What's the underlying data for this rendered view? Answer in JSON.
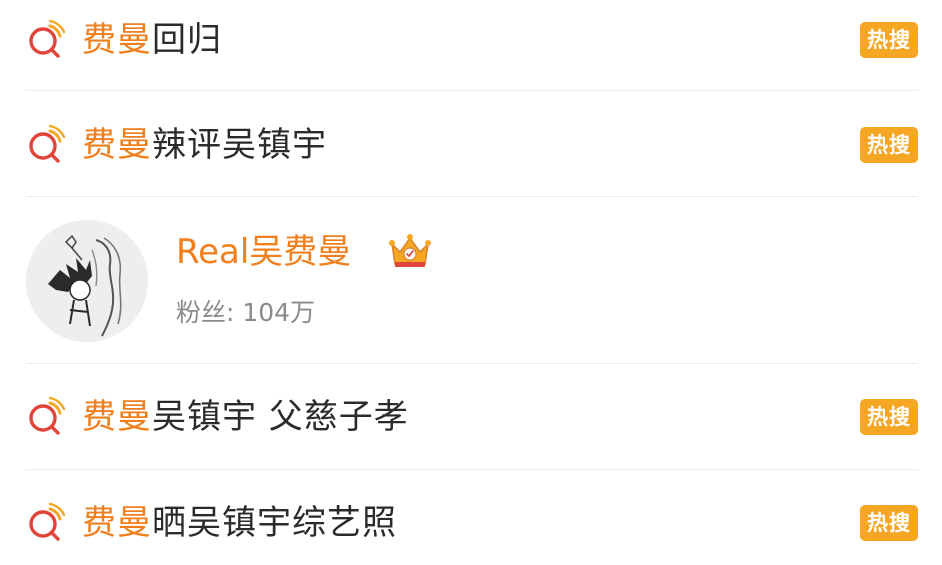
{
  "results": [
    {
      "highlight": "费曼",
      "rest": "回归",
      "badge": "热搜",
      "icon": "search-icon"
    },
    {
      "highlight": "费曼",
      "rest": "辣评吴镇宇",
      "badge": "热搜",
      "icon": "search-icon"
    },
    {
      "highlight": "费曼",
      "rest": "吴镇宇 父慈子孝",
      "badge": "热搜",
      "icon": "search-icon"
    },
    {
      "highlight": "费曼",
      "rest": "晒吴镇宇综艺照",
      "badge": "热搜",
      "icon": "search-icon"
    }
  ],
  "user": {
    "name": "Real吴费曼",
    "fans_label": "粉丝: 104万",
    "avatar": "avatar-illustration",
    "badge_icon": "crown-icon"
  },
  "colors": {
    "highlight": "#f07f1c",
    "badge_bg": "#f5a623",
    "icon_red": "#e0443a",
    "icon_orange": "#f5a623",
    "text": "#2b2b2b",
    "muted": "#8a8a8a"
  }
}
